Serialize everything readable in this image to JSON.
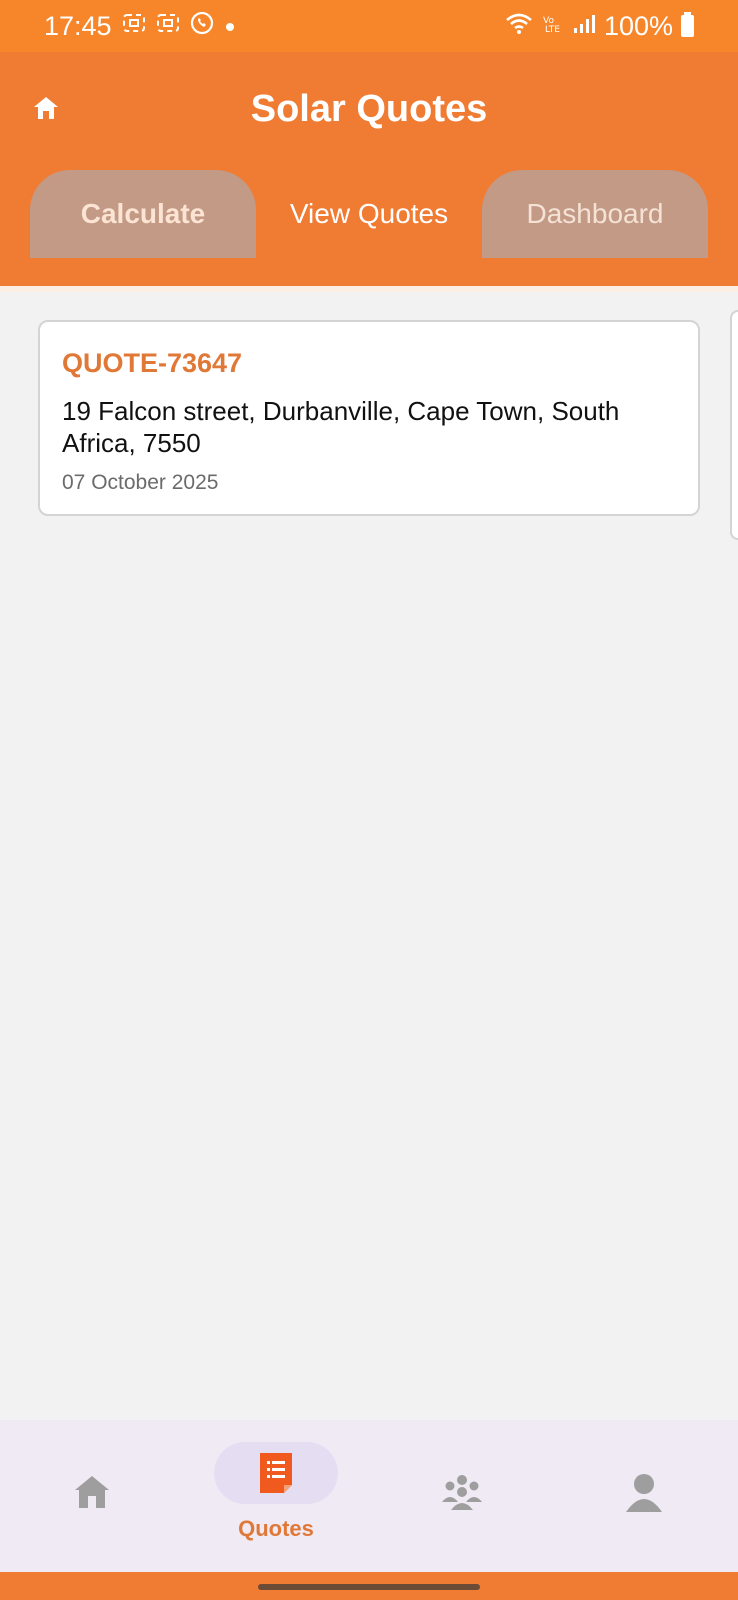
{
  "status_bar": {
    "time": "17:45",
    "battery": "100%"
  },
  "header": {
    "title": "Solar Quotes"
  },
  "tabs": [
    {
      "label": "Calculate"
    },
    {
      "label": "View Quotes"
    },
    {
      "label": "Dashboard"
    }
  ],
  "quotes": [
    {
      "id": "QUOTE-73647",
      "address": "19 Falcon street, Durbanville, Cape Town, South Africa, 7550",
      "date": "07 October 2025"
    }
  ],
  "bottom_nav": {
    "items": [
      {
        "icon": "home-icon",
        "label": ""
      },
      {
        "icon": "quotes-document-icon",
        "label": "Quotes"
      },
      {
        "icon": "team-icon",
        "label": ""
      },
      {
        "icon": "profile-icon",
        "label": ""
      }
    ],
    "active_index": 1
  },
  "colors": {
    "accent": "#f07b33",
    "status_bar": "#f7862a",
    "inactive_tab": "#c39a85",
    "quote_id": "#e07838",
    "nav_pill": "#e5def3",
    "nav_background": "#f0eaf4",
    "inactive_nav_icon": "#9e9e9e",
    "active_nav_icon": "#f05a1e"
  }
}
